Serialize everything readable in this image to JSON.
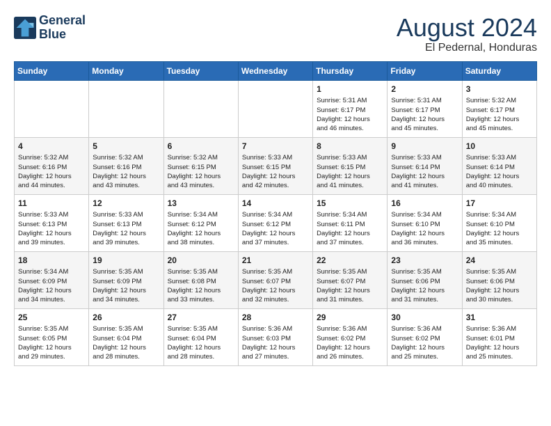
{
  "logo": {
    "line1": "General",
    "line2": "Blue"
  },
  "title": {
    "month_year": "August 2024",
    "location": "El Pedernal, Honduras"
  },
  "weekdays": [
    "Sunday",
    "Monday",
    "Tuesday",
    "Wednesday",
    "Thursday",
    "Friday",
    "Saturday"
  ],
  "weeks": [
    [
      {
        "day": "",
        "info": ""
      },
      {
        "day": "",
        "info": ""
      },
      {
        "day": "",
        "info": ""
      },
      {
        "day": "",
        "info": ""
      },
      {
        "day": "1",
        "info": "Sunrise: 5:31 AM\nSunset: 6:17 PM\nDaylight: 12 hours\nand 46 minutes."
      },
      {
        "day": "2",
        "info": "Sunrise: 5:31 AM\nSunset: 6:17 PM\nDaylight: 12 hours\nand 45 minutes."
      },
      {
        "day": "3",
        "info": "Sunrise: 5:32 AM\nSunset: 6:17 PM\nDaylight: 12 hours\nand 45 minutes."
      }
    ],
    [
      {
        "day": "4",
        "info": "Sunrise: 5:32 AM\nSunset: 6:16 PM\nDaylight: 12 hours\nand 44 minutes."
      },
      {
        "day": "5",
        "info": "Sunrise: 5:32 AM\nSunset: 6:16 PM\nDaylight: 12 hours\nand 43 minutes."
      },
      {
        "day": "6",
        "info": "Sunrise: 5:32 AM\nSunset: 6:15 PM\nDaylight: 12 hours\nand 43 minutes."
      },
      {
        "day": "7",
        "info": "Sunrise: 5:33 AM\nSunset: 6:15 PM\nDaylight: 12 hours\nand 42 minutes."
      },
      {
        "day": "8",
        "info": "Sunrise: 5:33 AM\nSunset: 6:15 PM\nDaylight: 12 hours\nand 41 minutes."
      },
      {
        "day": "9",
        "info": "Sunrise: 5:33 AM\nSunset: 6:14 PM\nDaylight: 12 hours\nand 41 minutes."
      },
      {
        "day": "10",
        "info": "Sunrise: 5:33 AM\nSunset: 6:14 PM\nDaylight: 12 hours\nand 40 minutes."
      }
    ],
    [
      {
        "day": "11",
        "info": "Sunrise: 5:33 AM\nSunset: 6:13 PM\nDaylight: 12 hours\nand 39 minutes."
      },
      {
        "day": "12",
        "info": "Sunrise: 5:33 AM\nSunset: 6:13 PM\nDaylight: 12 hours\nand 39 minutes."
      },
      {
        "day": "13",
        "info": "Sunrise: 5:34 AM\nSunset: 6:12 PM\nDaylight: 12 hours\nand 38 minutes."
      },
      {
        "day": "14",
        "info": "Sunrise: 5:34 AM\nSunset: 6:12 PM\nDaylight: 12 hours\nand 37 minutes."
      },
      {
        "day": "15",
        "info": "Sunrise: 5:34 AM\nSunset: 6:11 PM\nDaylight: 12 hours\nand 37 minutes."
      },
      {
        "day": "16",
        "info": "Sunrise: 5:34 AM\nSunset: 6:10 PM\nDaylight: 12 hours\nand 36 minutes."
      },
      {
        "day": "17",
        "info": "Sunrise: 5:34 AM\nSunset: 6:10 PM\nDaylight: 12 hours\nand 35 minutes."
      }
    ],
    [
      {
        "day": "18",
        "info": "Sunrise: 5:34 AM\nSunset: 6:09 PM\nDaylight: 12 hours\nand 34 minutes."
      },
      {
        "day": "19",
        "info": "Sunrise: 5:35 AM\nSunset: 6:09 PM\nDaylight: 12 hours\nand 34 minutes."
      },
      {
        "day": "20",
        "info": "Sunrise: 5:35 AM\nSunset: 6:08 PM\nDaylight: 12 hours\nand 33 minutes."
      },
      {
        "day": "21",
        "info": "Sunrise: 5:35 AM\nSunset: 6:07 PM\nDaylight: 12 hours\nand 32 minutes."
      },
      {
        "day": "22",
        "info": "Sunrise: 5:35 AM\nSunset: 6:07 PM\nDaylight: 12 hours\nand 31 minutes."
      },
      {
        "day": "23",
        "info": "Sunrise: 5:35 AM\nSunset: 6:06 PM\nDaylight: 12 hours\nand 31 minutes."
      },
      {
        "day": "24",
        "info": "Sunrise: 5:35 AM\nSunset: 6:06 PM\nDaylight: 12 hours\nand 30 minutes."
      }
    ],
    [
      {
        "day": "25",
        "info": "Sunrise: 5:35 AM\nSunset: 6:05 PM\nDaylight: 12 hours\nand 29 minutes."
      },
      {
        "day": "26",
        "info": "Sunrise: 5:35 AM\nSunset: 6:04 PM\nDaylight: 12 hours\nand 28 minutes."
      },
      {
        "day": "27",
        "info": "Sunrise: 5:35 AM\nSunset: 6:04 PM\nDaylight: 12 hours\nand 28 minutes."
      },
      {
        "day": "28",
        "info": "Sunrise: 5:36 AM\nSunset: 6:03 PM\nDaylight: 12 hours\nand 27 minutes."
      },
      {
        "day": "29",
        "info": "Sunrise: 5:36 AM\nSunset: 6:02 PM\nDaylight: 12 hours\nand 26 minutes."
      },
      {
        "day": "30",
        "info": "Sunrise: 5:36 AM\nSunset: 6:02 PM\nDaylight: 12 hours\nand 25 minutes."
      },
      {
        "day": "31",
        "info": "Sunrise: 5:36 AM\nSunset: 6:01 PM\nDaylight: 12 hours\nand 25 minutes."
      }
    ]
  ]
}
